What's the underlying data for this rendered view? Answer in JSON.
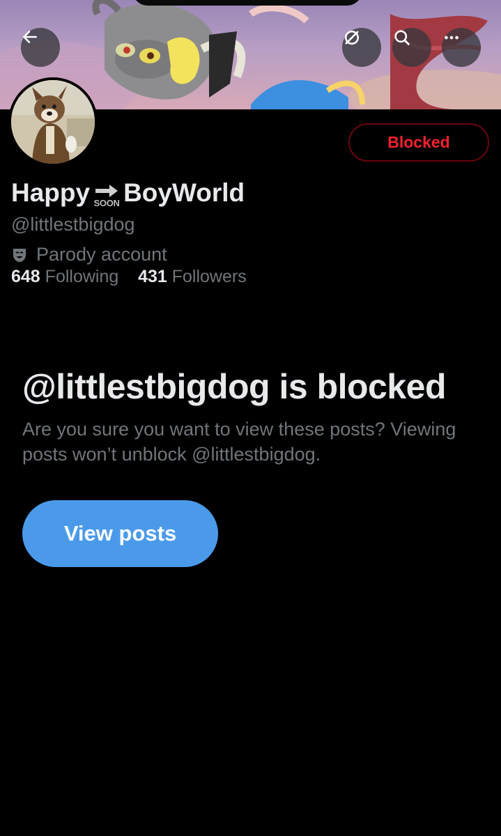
{
  "banner": {
    "back_icon": "arrow-left-icon",
    "grok_icon": "grok-icon",
    "search_icon": "search-icon",
    "more_icon": "more-horizontal-icon"
  },
  "profile": {
    "name_before": "Happy",
    "name_emoji_text": "SOON",
    "name_after": "BoyWorld",
    "handle": "@littlestbigdog",
    "parody_label": "Parody account",
    "following_count": "648",
    "following_label": "Following",
    "followers_count": "431",
    "followers_label": "Followers",
    "blocked_button": "Blocked"
  },
  "blocked_notice": {
    "title": "@littlestbigdog is blocked",
    "description": "Are you sure you want to view these posts? Viewing posts won’t unblock @littlestbigdog.",
    "view_button": "View posts"
  },
  "colors": {
    "background": "#000000",
    "blocked_red": "#f4212e",
    "view_button_blue": "#4a9ae9",
    "muted_text": "#71767b"
  }
}
